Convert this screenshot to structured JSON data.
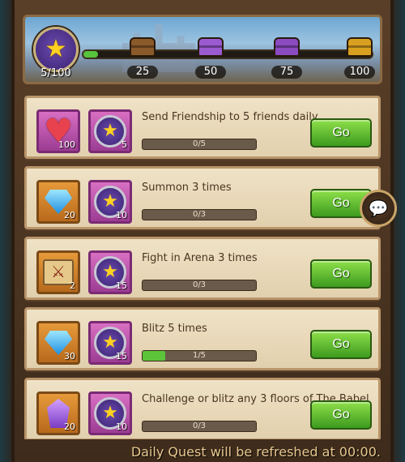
{
  "header": {
    "progress_count": "5/100",
    "progress_fraction": 0.05,
    "milestones": [
      {
        "label": "25",
        "chest": "wooden-chest",
        "color": "#8a5a2a"
      },
      {
        "label": "50",
        "chest": "purple-chest",
        "color": "#9a5ad0"
      },
      {
        "label": "75",
        "chest": "purple-chest",
        "color": "#8a4ac0"
      },
      {
        "label": "100",
        "chest": "golden-chest",
        "color": "#d9a020"
      }
    ]
  },
  "quests": [
    {
      "title": "Send Friendship to 5 friends daily",
      "reward1_icon": "heart-icon",
      "reward1_count": "100",
      "reward2_count": "5",
      "progress": "0/5",
      "progress_fraction": 0,
      "go": "Go"
    },
    {
      "title": "Summon 3 times",
      "reward1_icon": "diamond-icon",
      "reward1_count": "20",
      "reward2_count": "10",
      "progress": "0/3",
      "progress_fraction": 0,
      "go": "Go"
    },
    {
      "title": "Fight in Arena 3 times",
      "reward1_icon": "arena-scroll-icon",
      "reward1_count": "2",
      "reward2_count": "15",
      "progress": "0/3",
      "progress_fraction": 0,
      "go": "Go"
    },
    {
      "title": "Blitz 5 times",
      "reward1_icon": "diamond-icon",
      "reward1_count": "30",
      "reward2_count": "15",
      "progress": "1/5",
      "progress_fraction": 0.2,
      "go": "Go"
    },
    {
      "title": "Challenge or blitz any 3 floors of The Babel",
      "reward1_icon": "crystal-icon",
      "reward1_count": "20",
      "reward2_count": "10",
      "progress": "0/3",
      "progress_fraction": 0,
      "go": "Go"
    }
  ],
  "footer": "Daily Quest will be refreshed at 00:00."
}
